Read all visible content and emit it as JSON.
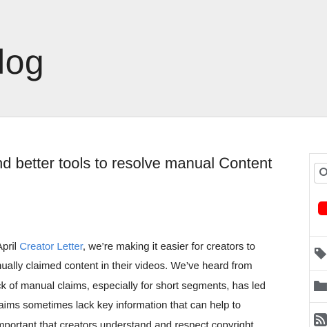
{
  "header": {
    "blog_title": "log"
  },
  "post": {
    "title": "nd better tools to resolve manual Content",
    "body": {
      "line1_prefix": "April ",
      "line1_link": "Creator Letter",
      "line1_suffix": ", we’re making it easier for creators to",
      "line2": "nually claimed content in their videos. We’ve heard from",
      "line3": "ck of manual claims, especially for short segments, has led",
      "line4": "laims sometimes lack key information that can help to",
      "line5": "mportant that creators understand and respect copyright"
    }
  },
  "sidebar": {
    "icons": [
      "search-icon",
      "youtube-logo-icon",
      "tag-icon",
      "folder-icon",
      "rss-icon"
    ]
  },
  "colors": {
    "header_bg": "#eeeeee",
    "link": "#3a7fd5",
    "youtube_red": "#ff0000",
    "icon_gray": "#5f6368"
  }
}
